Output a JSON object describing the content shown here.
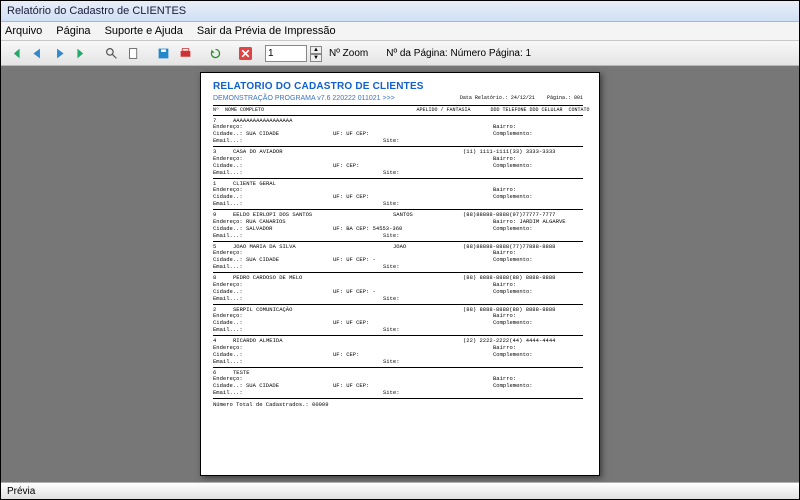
{
  "window": {
    "title": "Relatório do Cadastro de CLIENTES"
  },
  "menu": {
    "arquivo": "Arquivo",
    "pagina": "Página",
    "suporte": "Suporte e Ajuda",
    "sair": "Sair da Prévia de Impressão"
  },
  "toolbar": {
    "zoom_value": "1",
    "zoom_label": "Nº Zoom",
    "page_label": "Nº da Página:",
    "page_value": "Número Página: 1"
  },
  "report": {
    "title": "RELATORIO DO CADASTRO DE CLIENTES",
    "subtitle": "DEMONSTRAÇÃO PROGRAMA v7.6 220222 011021 >>>",
    "meta_date_label": "Data Relatório.:",
    "meta_date": "24/12/21",
    "meta_page_label": "Página.:",
    "meta_page": "001",
    "header": {
      "num": "Nº",
      "nome": "NOME COMPLETO",
      "apelido": "APELIDO / FANTASIA",
      "tel": "DDD TELEFONE  DDD CELULAR",
      "contato": "CONTATO"
    },
    "labels": {
      "endereco": "Endereço:",
      "cidade": "Cidade..:",
      "uf": "UF:",
      "cep": "CEP:",
      "bairro": "Bairro:",
      "complemento": "Complemento:",
      "email": "Email...:",
      "site": "Site:"
    },
    "records": [
      {
        "num": "7",
        "nome": "AAAAAAAAAAAAAAAAAA",
        "apelido": "",
        "tel": "",
        "cidade": "SUA CIDADE",
        "uf": "UF",
        "cep": "",
        "bairro": ""
      },
      {
        "num": "3",
        "nome": "CASA DO AVIADOR",
        "apelido": "",
        "tel": "(11) 1111-1111(33) 3333-3333",
        "cidade": "",
        "uf": "",
        "cep": "",
        "bairro": ""
      },
      {
        "num": "1",
        "nome": "CLIENTE GERAL",
        "apelido": "",
        "tel": "",
        "cidade": "",
        "uf": "UF",
        "cep": "",
        "bairro": ""
      },
      {
        "num": "9",
        "nome": "EELDO EIRLOPI DOS SANTOS",
        "apelido": "SANTOS",
        "tel": "(88)88888-8888(97)77777-7777",
        "endereco": "RUA CANARIOS",
        "cidade": "SALVADOR",
        "uf": "BA",
        "cep": "54553-360",
        "bairro": "JARDIM ALGARVE"
      },
      {
        "num": "5",
        "nome": "JOAO MARIA DA SILVA",
        "apelido": "JOAO",
        "tel": "(88)88888-8888(77)77888-8888",
        "cidade": "SUA CIDADE",
        "uf": "UF",
        "cep": "        -",
        "bairro": ""
      },
      {
        "num": "8",
        "nome": "PEDRO CARDOSO DE MELO",
        "apelido": "",
        "tel": "(88) 8888-8888(88) 8888-8888",
        "cidade": "",
        "uf": "UF",
        "cep": "        -",
        "bairro": ""
      },
      {
        "num": "2",
        "nome": "SERPIL COMUNICAÇÃO",
        "apelido": "",
        "tel": "(88) 8888-8888(88) 8888-8888",
        "cidade": "",
        "uf": "UF",
        "cep": "",
        "bairro": ""
      },
      {
        "num": "4",
        "nome": "RICARDO ALMEIDA",
        "apelido": "",
        "tel": "(22) 2222-2222(44) 4444-4444",
        "cidade": "",
        "uf": "",
        "cep": "",
        "bairro": ""
      },
      {
        "num": "6",
        "nome": "TESTE",
        "apelido": "",
        "tel": "",
        "cidade": "SUA CIDADE",
        "uf": "UF",
        "cep": "",
        "bairro": ""
      }
    ],
    "total_label": "Número Total de Cadastrados.:",
    "total_value": "00009"
  },
  "status": {
    "text": "Prévia"
  }
}
